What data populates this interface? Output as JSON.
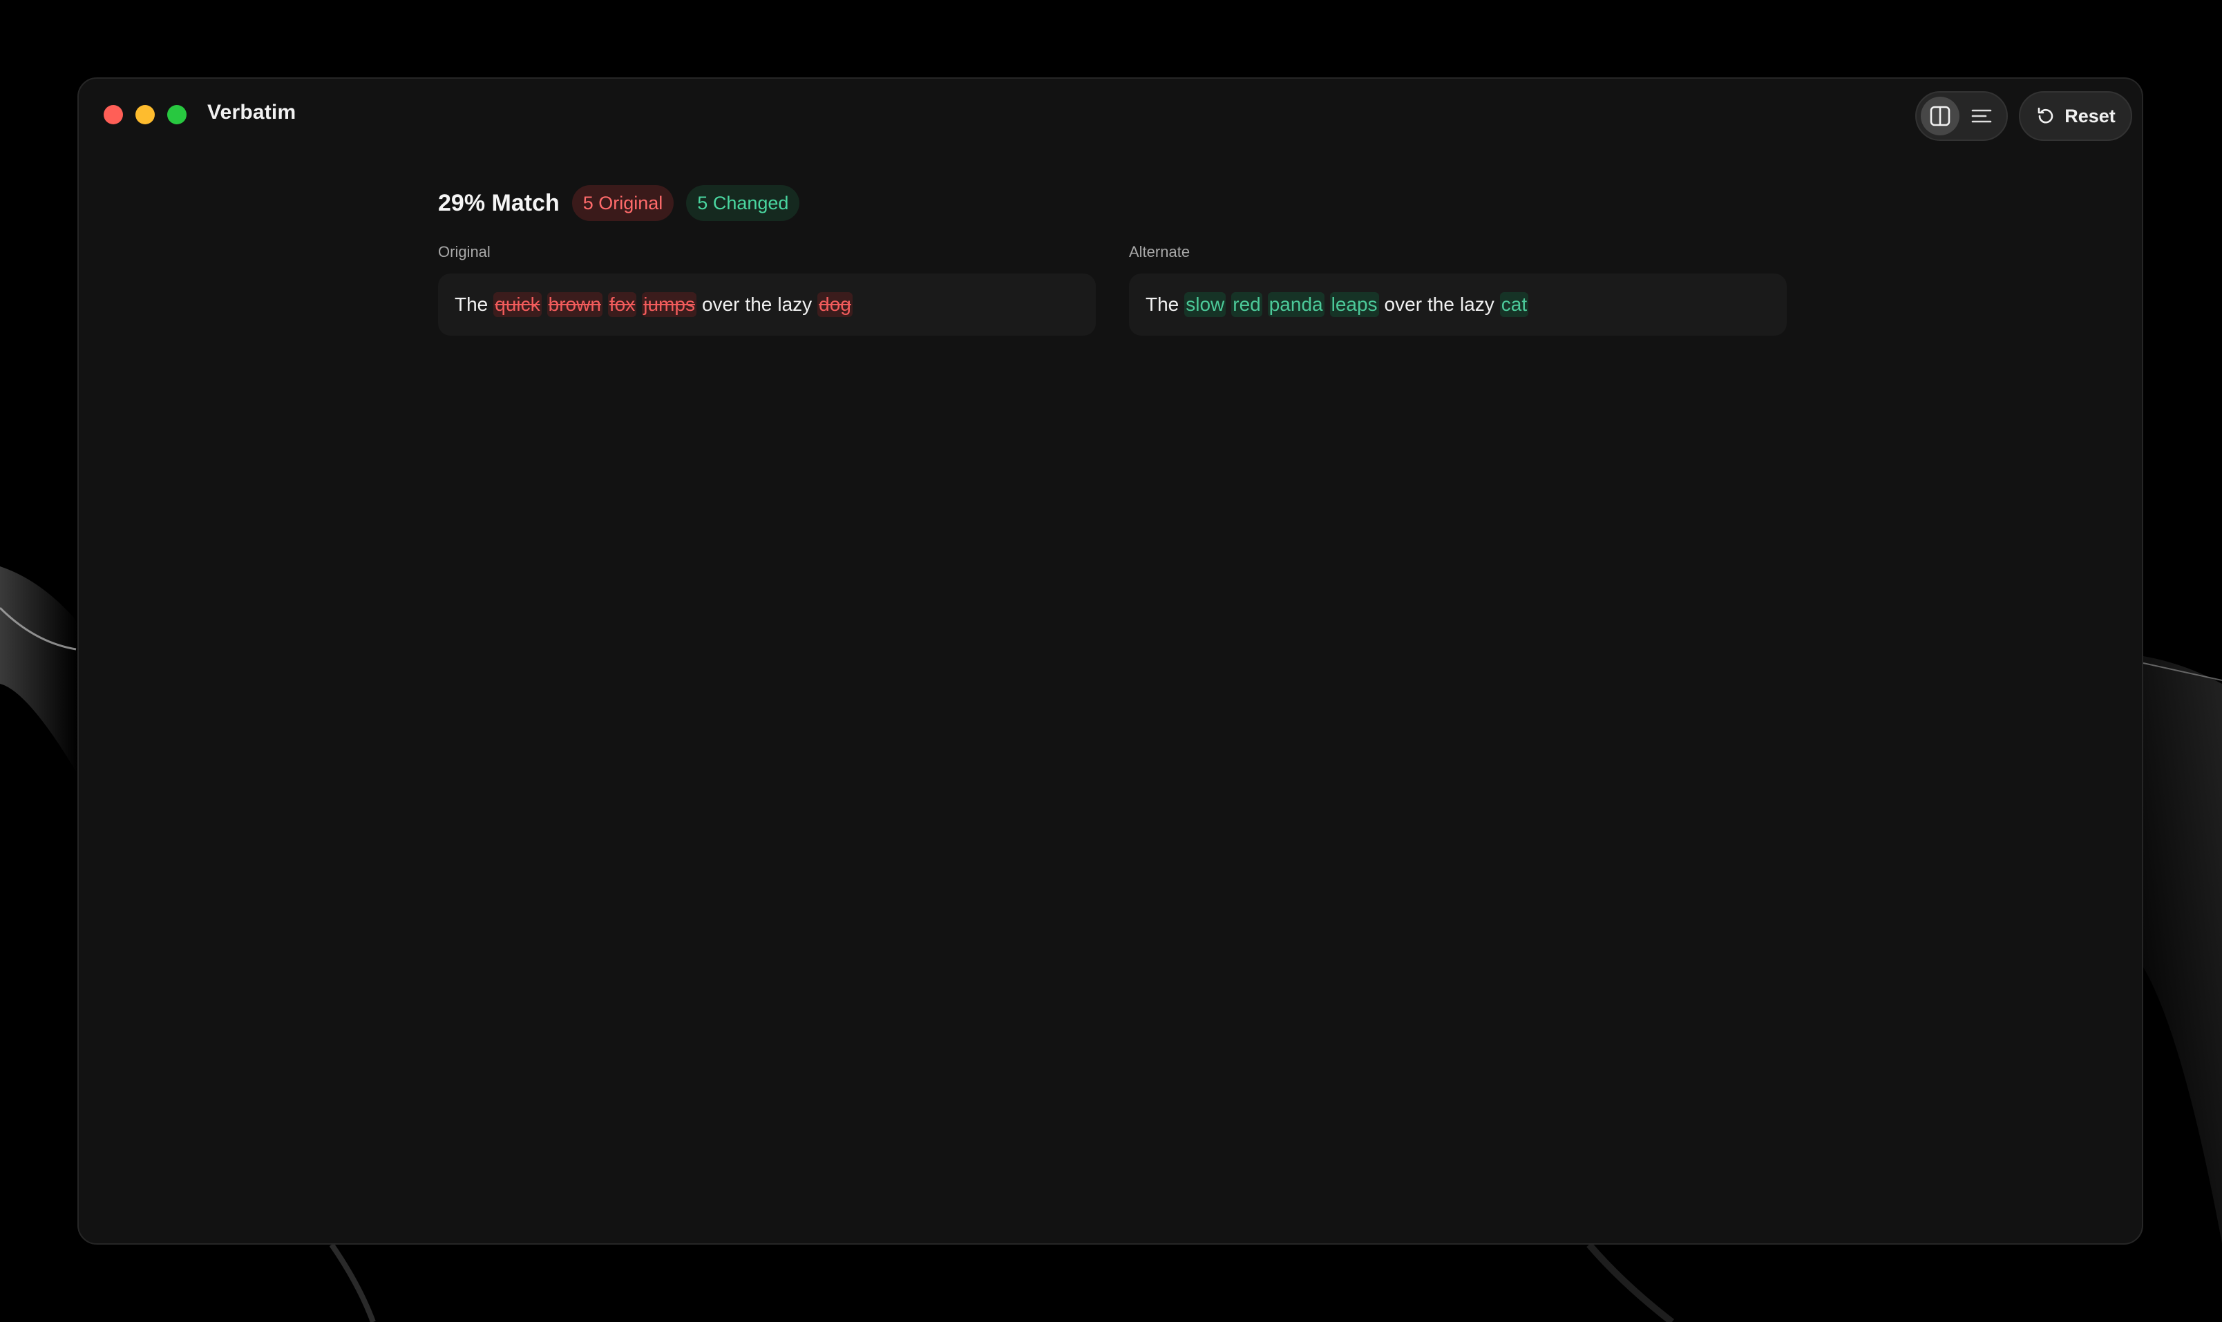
{
  "window": {
    "title": "Verbatim"
  },
  "toolbar": {
    "reset_label": "Reset",
    "split_view_icon": "split-view-icon",
    "unified_view_icon": "lines-icon",
    "reset_icon": "rotate-ccw-icon"
  },
  "summary": {
    "match": "29% Match",
    "original_count": "5 Original",
    "changed_count": "5 Changed"
  },
  "original": {
    "label": "Original",
    "words": [
      {
        "text": "The",
        "status": "same"
      },
      {
        "text": "quick",
        "status": "removed"
      },
      {
        "text": "brown",
        "status": "removed"
      },
      {
        "text": "fox",
        "status": "removed"
      },
      {
        "text": "jumps",
        "status": "removed"
      },
      {
        "text": "over",
        "status": "same"
      },
      {
        "text": "the",
        "status": "same"
      },
      {
        "text": "lazy",
        "status": "same"
      },
      {
        "text": "dog",
        "status": "removed"
      }
    ]
  },
  "alternate": {
    "label": "Alternate",
    "words": [
      {
        "text": "The",
        "status": "same"
      },
      {
        "text": "slow",
        "status": "added"
      },
      {
        "text": "red",
        "status": "added"
      },
      {
        "text": "panda",
        "status": "added"
      },
      {
        "text": "leaps",
        "status": "added"
      },
      {
        "text": "over",
        "status": "same"
      },
      {
        "text": "the",
        "status": "same"
      },
      {
        "text": "lazy",
        "status": "same"
      },
      {
        "text": "cat",
        "status": "added"
      }
    ]
  },
  "colors": {
    "removed_text": "#f25c5c",
    "removed_bg": "#3b1c1c",
    "added_text": "#4cc999",
    "added_bg": "#163326",
    "window_bg": "#121212"
  }
}
